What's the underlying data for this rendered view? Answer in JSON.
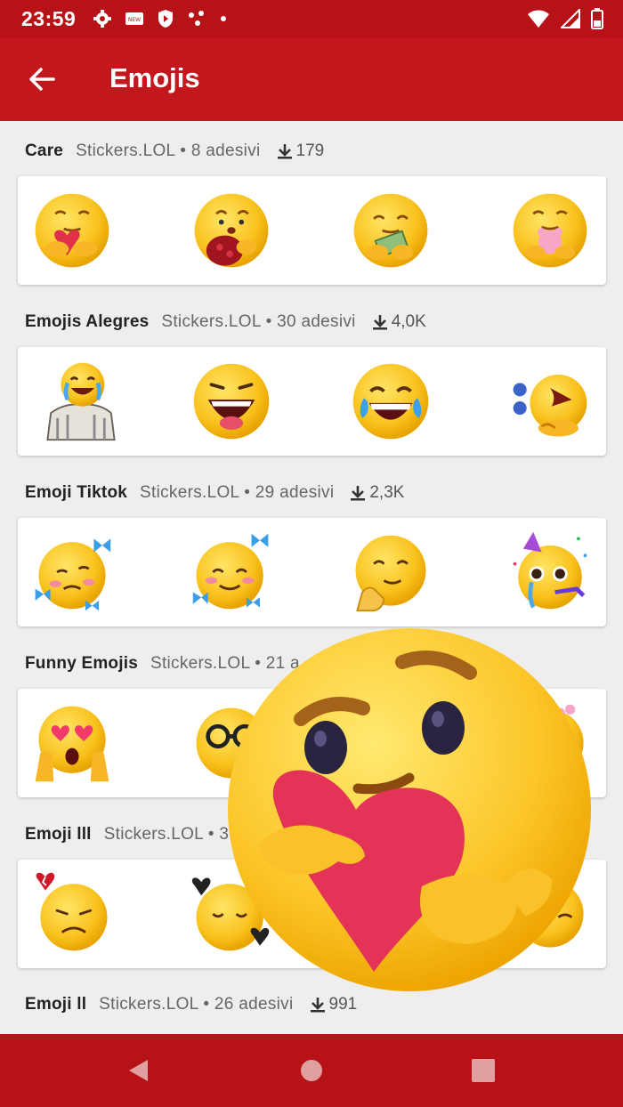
{
  "status_bar": {
    "time": "23:59",
    "left_icons": [
      "gear-icon",
      "new-badge-icon",
      "shield-icon",
      "dots-icon",
      "dot-icon"
    ],
    "right_icons": [
      "wifi-icon",
      "cell-signal-icon",
      "battery-icon"
    ]
  },
  "app_bar": {
    "title": "Emojis",
    "back_icon": "arrow-back-icon"
  },
  "packs": [
    {
      "name": "Care",
      "author": "Stickers.LOL • 8 adesivi",
      "downloads": "179"
    },
    {
      "name": "Emojis Alegres",
      "author": "Stickers.LOL • 30 adesivi",
      "downloads": "4,0K"
    },
    {
      "name": "Emoji Tiktok",
      "author": "Stickers.LOL • 29 adesivi",
      "downloads": "2,3K"
    },
    {
      "name": "Funny Emojis",
      "author": "Stickers.LOL • 21 a",
      "downloads": ""
    },
    {
      "name": "Emoji lll",
      "author": "Stickers.LOL • 3",
      "downloads": ""
    },
    {
      "name": "Emoji ll",
      "author": "Stickers.LOL • 26 adesivi",
      "downloads": "991"
    }
  ],
  "nav_bar": {
    "icons": [
      "back-triangle-icon",
      "home-circle-icon",
      "recents-square-icon"
    ]
  },
  "colors": {
    "toolbar": "#c2171d",
    "status_bar": "#b71217",
    "background": "#eeeeee",
    "card": "#ffffff"
  }
}
